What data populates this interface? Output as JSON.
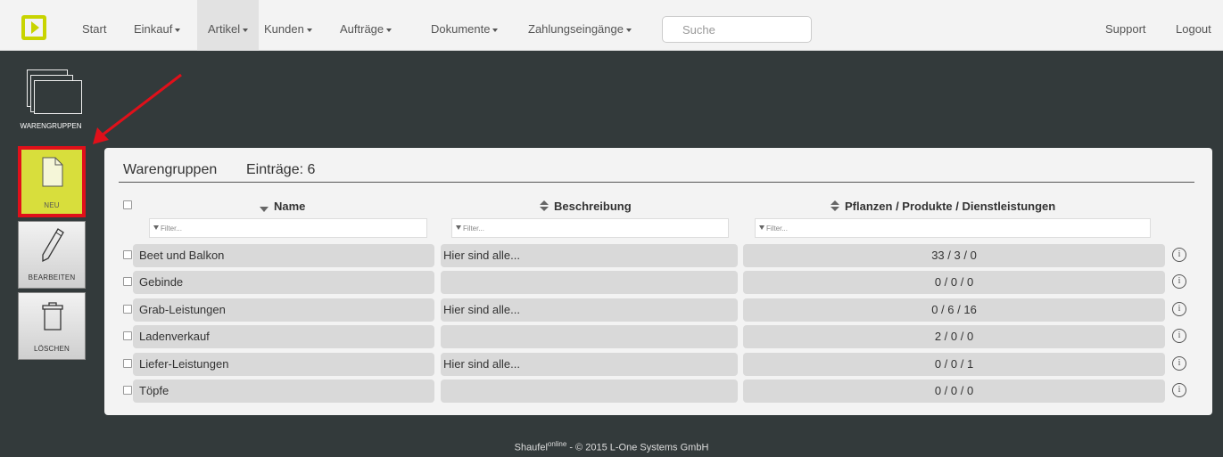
{
  "nav": {
    "items": [
      {
        "label": "Start",
        "dropdown": false
      },
      {
        "label": "Einkauf",
        "dropdown": true
      },
      {
        "label": "Artikel",
        "dropdown": true,
        "active": true
      },
      {
        "label": "Kunden",
        "dropdown": true
      },
      {
        "label": "Aufträge",
        "dropdown": true
      },
      {
        "label": "Dokumente",
        "dropdown": true
      },
      {
        "label": "Zahlungseingänge",
        "dropdown": true
      }
    ],
    "search_placeholder": "Suche",
    "support": "Support",
    "logout": "Logout"
  },
  "sidebar": {
    "warengruppen": "WARENGRUPPEN",
    "neu": "NEU",
    "bearbeiten": "BEARBEITEN",
    "loeschen": "LÖSCHEN"
  },
  "panel": {
    "title": "Warengruppen",
    "count": "Einträge: 6",
    "columns": {
      "name": "Name",
      "beschreibung": "Beschreibung",
      "counts": "Pflanzen / Produkte / Dienstleistungen"
    },
    "filter_placeholder": "Filter...",
    "rows": [
      {
        "name": "Beet und Balkon",
        "beschreibung": "Hier sind alle...",
        "counts": "33 / 3 / 0"
      },
      {
        "name": "Gebinde",
        "beschreibung": "",
        "counts": "0 / 0 / 0"
      },
      {
        "name": "Grab-Leistungen",
        "beschreibung": "Hier sind alle...",
        "counts": "0 / 6 / 16"
      },
      {
        "name": "Ladenverkauf",
        "beschreibung": "",
        "counts": "2 / 0 / 0"
      },
      {
        "name": "Liefer-Leistungen",
        "beschreibung": "Hier sind alle...",
        "counts": "0 / 0 / 1"
      },
      {
        "name": "Töpfe",
        "beschreibung": "",
        "counts": "0 / 0 / 0"
      }
    ],
    "info_glyph": "i"
  },
  "footer": {
    "brand": "Shaufel",
    "brand_sup": "online",
    "rest": " - © 2015 L-One Systems GmbH"
  },
  "colors": {
    "accent": "#d8de3c",
    "highlight": "#e0101a",
    "background": "#333a3b"
  }
}
